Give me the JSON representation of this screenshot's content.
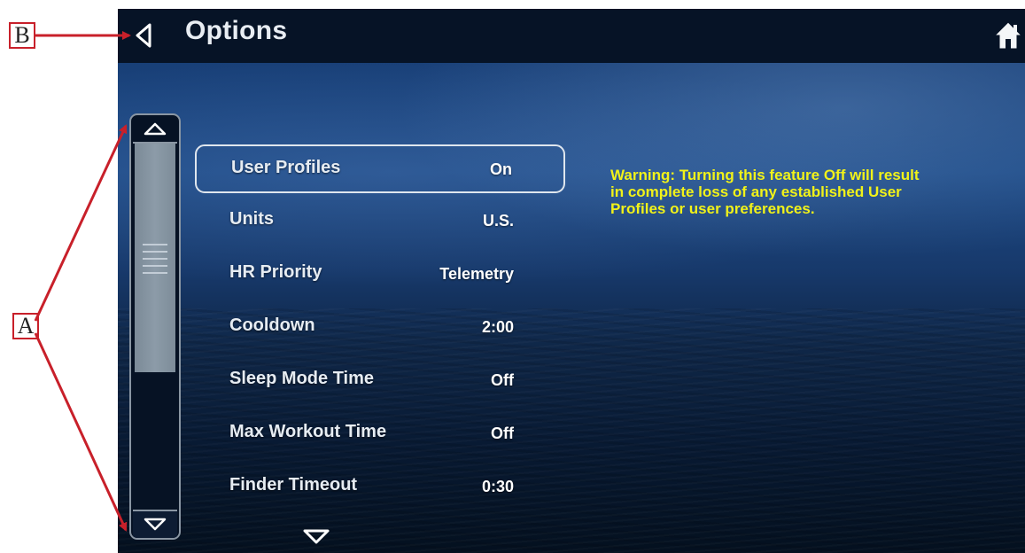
{
  "annotations": {
    "callout_a": "A",
    "callout_b": "B"
  },
  "header": {
    "title": "Options",
    "back_icon": "back-triangle-icon",
    "home_icon": "home-icon"
  },
  "options": [
    {
      "label": "User Profiles",
      "value": "On",
      "selected": true
    },
    {
      "label": "Units",
      "value": "U.S."
    },
    {
      "label": "HR Priority",
      "value": "Telemetry"
    },
    {
      "label": "Cooldown",
      "value": "2:00"
    },
    {
      "label": "Sleep Mode Time",
      "value": "Off"
    },
    {
      "label": "Max Workout Time",
      "value": "Off"
    },
    {
      "label": "Finder Timeout",
      "value": "0:30"
    }
  ],
  "warning": "Warning: Turning this feature Off will result in complete loss of any established User Profiles or user preferences.",
  "colors": {
    "warning_text": "#f1f219",
    "topbar": "#061326",
    "callout_border": "#c8202a"
  }
}
